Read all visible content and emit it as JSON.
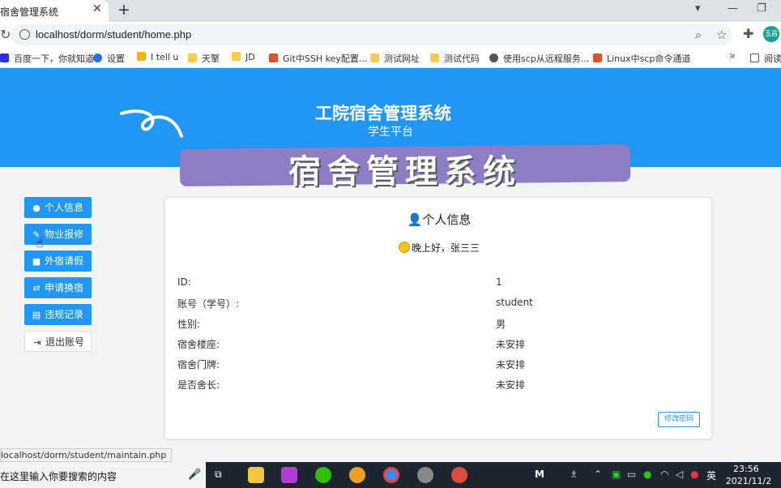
{
  "browser": {
    "tab_title": "宿舍管理系统",
    "url": "localhost/dorm/student/home.php",
    "bookmarks": [
      "百度一下，你就知道",
      "设置",
      "I tell u",
      "天擎",
      "JD",
      "Git中SSH key配置...",
      "测试网址",
      "测试代码",
      "使用scp从远程服务...",
      "Linux中scp命令通道",
      "阅读"
    ],
    "status_url": "localhost/dorm/student/maintain.php"
  },
  "colors": {
    "primary": "#2196f3",
    "overlay": "#8c7dc4"
  },
  "header": {
    "title": "工院宿舍管理系统",
    "subtitle": "学生平台",
    "overlay_text": "宿舍管理系统"
  },
  "sidebar": {
    "items": [
      {
        "icon": "user-icon",
        "label": "个人信息"
      },
      {
        "icon": "wrench-icon",
        "label": "物业报修"
      },
      {
        "icon": "lock-icon",
        "label": "外宿请假"
      },
      {
        "icon": "swap-icon",
        "label": "申请换宿"
      },
      {
        "icon": "clipboard-icon",
        "label": "违规记录"
      },
      {
        "icon": "sign-out-icon",
        "label": "退出账号"
      }
    ]
  },
  "profile": {
    "title": "个人信息",
    "greeting": "晚上好，张三三",
    "fields": [
      {
        "label": "ID:",
        "value": "1"
      },
      {
        "label": "账号（学号）:",
        "value": "student"
      },
      {
        "label": "性别:",
        "value": "男"
      },
      {
        "label": "宿舍楼座:",
        "value": "未安排"
      },
      {
        "label": "宿舍门牌:",
        "value": "未安排"
      },
      {
        "label": "是否舍长:",
        "value": "未安排"
      }
    ],
    "change_password": "修改密码"
  },
  "taskbar": {
    "search_placeholder": "在这里输入你要搜索的内容",
    "ime": "英",
    "time": "23:56",
    "date": "2021/11/2"
  }
}
